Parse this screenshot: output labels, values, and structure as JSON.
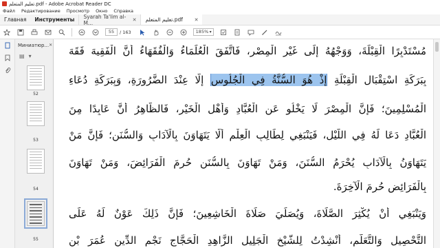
{
  "window": {
    "title": "تعليم المتعلم.pdf - Adobe Acrobat Reader DC"
  },
  "menu": [
    "Файл",
    "Редактирование",
    "Просмотр",
    "Окно",
    "Справка"
  ],
  "nav": {
    "home": "Главная",
    "tools": "Инструменты"
  },
  "tabs": [
    {
      "label": "Syarah Ta'lim al-M...",
      "active": false
    },
    {
      "label": "تعليم المتعلم.pdf",
      "active": true
    }
  ],
  "toolbar": {
    "page_current": "55",
    "page_total": "/ 163",
    "zoom": "185%"
  },
  "thumbnails": {
    "header": "Миниатюр...",
    "pages": [
      {
        "num": "52",
        "selected": false
      },
      {
        "num": "53",
        "selected": false
      },
      {
        "num": "54",
        "selected": false
      },
      {
        "num": "55",
        "selected": true
      }
    ]
  },
  "document": {
    "lines": [
      {
        "text": "مُسْتَدْبِرًا الْقِبْلَةَ، وَوَجْهُهُ إِلَى غَيْرِ الْمِصْرِ، فَاتَّفَقَ الْعُلَمَاءُ وَالْفُقَهَاءُ أَنَّ الْفَقِيهَ فَقَهَ"
      },
      {
        "pre": "بِبَرَكَةِ اسْتِقْبَالِ الْقِبْلَةِ ",
        "highlight": "إِذْ هُوَ السُّنَّةُ فِي الْجُلُوسِ",
        "post": " إِلَّا عِنْدَ الضَّرُورَةِ، وَبِبَرَكَةِ دُعَاءِ"
      },
      {
        "text": "الْمُسْلِمِينَ؛ فَإِنَّ الْمِصْرَ لَا يَخْلُو عَنِ الْعُبَّادِ وَأَهْلِ الْخَيْرِ، فَالظَّاهِرُ أَنَّ عَابِدًا مِنَ"
      },
      {
        "text": "الْعُبَّادِ دَعَا لَهُ فِي اللَّيْلِ، فَيَنْبَغِي لِطَالِبِ الْعِلْمِ أَلَّا يَتَهَاوَنَ بِالْآدَابِ وَالسُّنَنِ؛ فَإِنَّ مَنْ"
      },
      {
        "text": "يَتَهَاوَنُ بِالْآدَابِ يُحْرَمُ السُّنَنَ، وَمَنْ تَهَاوَنَ بِالسُّنَنِ حُرِمَ الْفَرَائِضَ، وَمَنْ تَهَاوَنَ"
      },
      {
        "text": "بِالْفَرَائِضِ حُرِمَ الْآخِرَةَ.",
        "last": true
      },
      {
        "text": "وَيَنْبَغِي أَنْ يُكْثِرَ الصَّلَاةَ، وَيُصَلِّيَ صَلَاةَ الْخَاشِعِينَ؛ فَإِنَّ ذَلِكَ عَوْنٌ لَهُ عَلَى"
      },
      {
        "text": "التَّحْصِيلِ وَالتَّعَلُّمِ، أُنْشِدْتُ لِلشَّيْخِ الْجَلِيلِ الزَّاهِدِ الْحَجَّاجِ نَجْمِ الدِّينِ عُمَرَ بْنِ"
      }
    ]
  }
}
